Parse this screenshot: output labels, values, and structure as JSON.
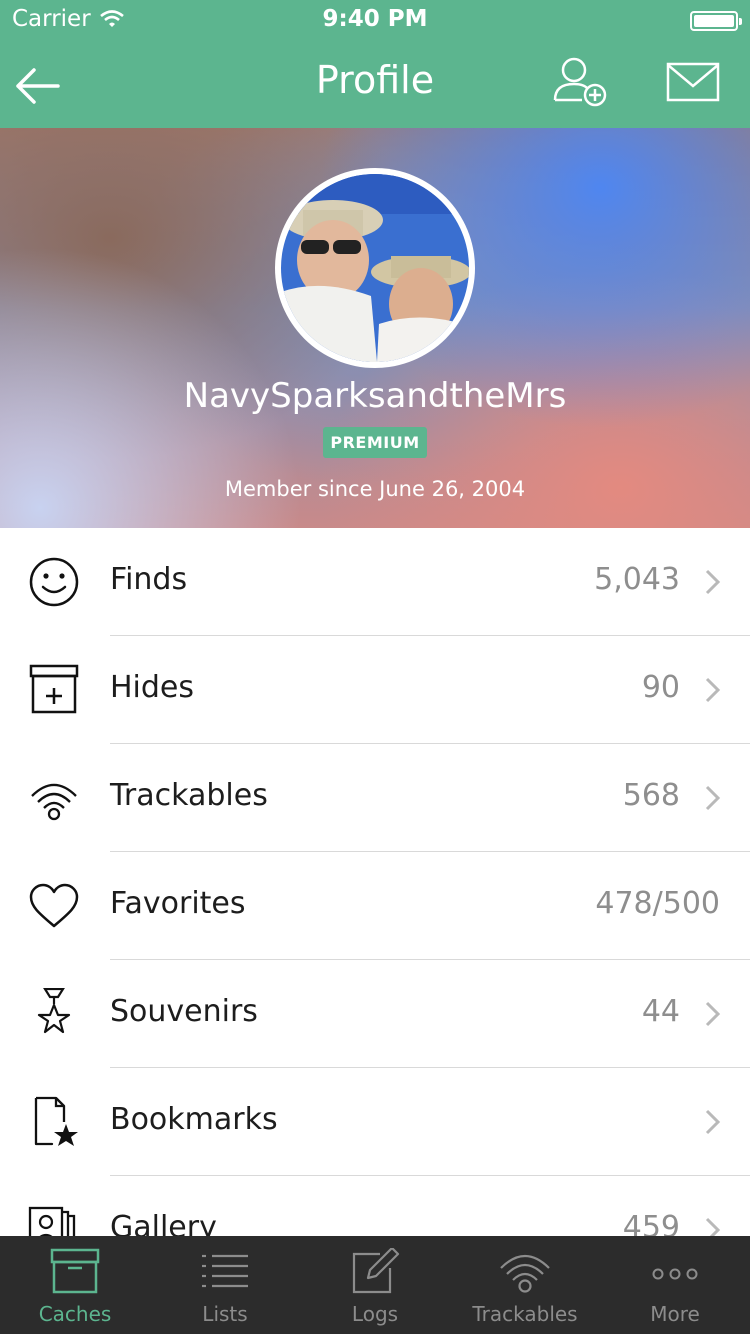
{
  "status_bar": {
    "carrier": "Carrier",
    "time": "9:40 PM"
  },
  "nav": {
    "title": "Profile",
    "back_icon": "arrow-left-icon",
    "add_friend_icon": "add-friend-icon",
    "message_icon": "mail-icon"
  },
  "profile": {
    "username": "NavySparksandtheMrs",
    "badge": "PREMIUM",
    "member_since": "Member since June 26, 2004"
  },
  "stats": [
    {
      "label": "Finds",
      "value": "5,043",
      "icon": "smiley-icon",
      "chevron": true
    },
    {
      "label": "Hides",
      "value": "90",
      "icon": "hide-box-icon",
      "chevron": true
    },
    {
      "label": "Trackables",
      "value": "568",
      "icon": "trackable-signal-icon",
      "chevron": true
    },
    {
      "label": "Favorites",
      "value": "478/500",
      "icon": "heart-icon",
      "chevron": false
    },
    {
      "label": "Souvenirs",
      "value": "44",
      "icon": "medal-icon",
      "chevron": true
    },
    {
      "label": "Bookmarks",
      "value": "",
      "icon": "bookmark-star-icon",
      "chevron": true
    },
    {
      "label": "Gallery",
      "value": "459",
      "icon": "gallery-icon",
      "chevron": true
    }
  ],
  "tabs": [
    {
      "label": "Caches",
      "icon": "caches-icon",
      "active": true
    },
    {
      "label": "Lists",
      "icon": "lists-icon",
      "active": false
    },
    {
      "label": "Logs",
      "icon": "logs-icon",
      "active": false
    },
    {
      "label": "Trackables",
      "icon": "trackables-icon",
      "active": false
    },
    {
      "label": "More",
      "icon": "more-icon",
      "active": false
    }
  ],
  "colors": {
    "brand_green": "#5cb58f",
    "tabbar_bg": "#2c2c2c",
    "value_gray": "#8e8e8e"
  }
}
